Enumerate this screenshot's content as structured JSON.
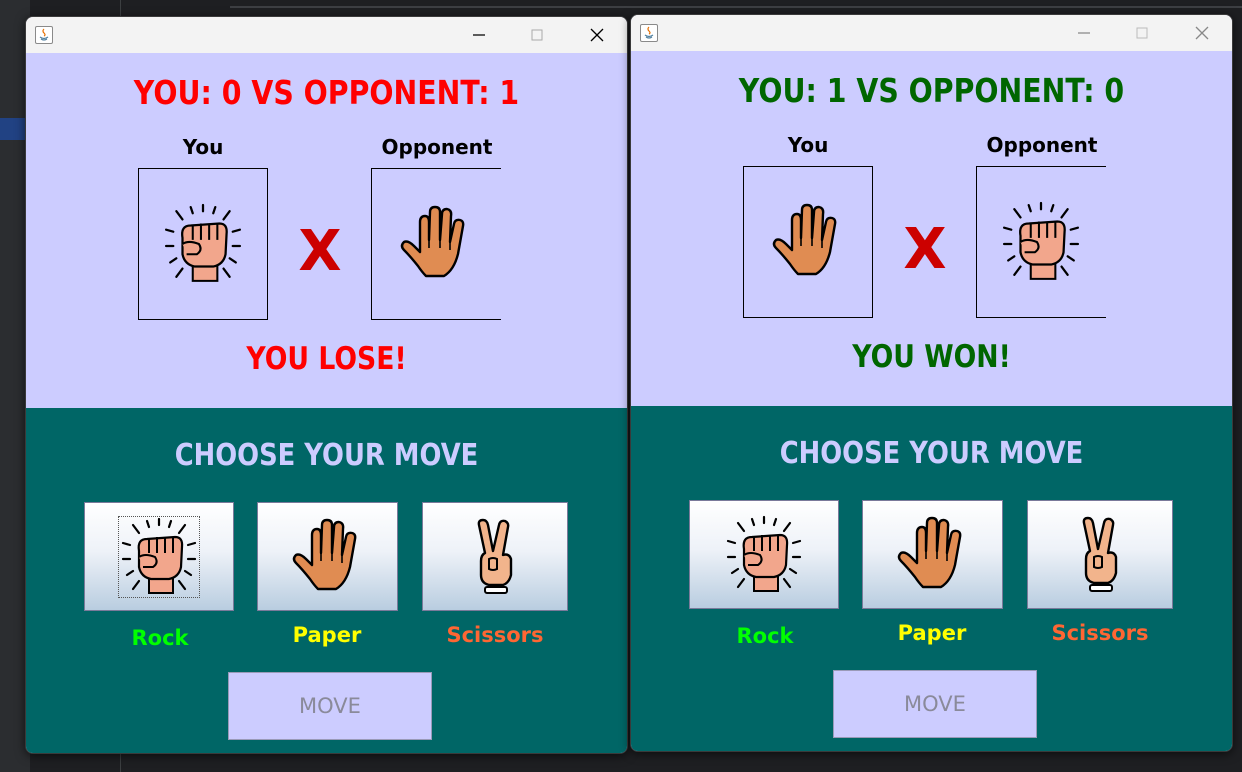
{
  "colors": {
    "lose": "#ff0000",
    "win": "#006600",
    "vs_x": "#cc0000",
    "panel_top": "#ccccff",
    "panel_bottom": "#006666",
    "rock_label": "#00ff00",
    "paper_label": "#ffff00",
    "scissors_label": "#ff6633"
  },
  "windows": [
    {
      "controls": [
        "minimize-icon",
        "maximize-icon",
        "close-icon"
      ],
      "score_text": "YOU: 0 VS OPPONENT: 1",
      "you_label": "You",
      "opponent_label": "Opponent",
      "you_hand": "rock-hand-icon",
      "opponent_hand": "paper-hand-icon",
      "vs_symbol": "X",
      "result_text": "YOU LOSE!",
      "choose_text": "CHOOSE YOUR MOVE",
      "moves": [
        {
          "label": "Rock",
          "icon": "rock-hand-icon"
        },
        {
          "label": "Paper",
          "icon": "paper-hand-icon"
        },
        {
          "label": "Scissors",
          "icon": "scissors-hand-icon"
        }
      ],
      "submit_label": "MOVE"
    },
    {
      "controls": [
        "minimize-icon",
        "maximize-icon",
        "close-icon"
      ],
      "score_text": "YOU: 1 VS OPPONENT: 0",
      "you_label": "You",
      "opponent_label": "Opponent",
      "you_hand": "paper-hand-icon",
      "opponent_hand": "rock-hand-icon",
      "vs_symbol": "X",
      "result_text": "YOU WON!",
      "choose_text": "CHOOSE YOUR MOVE",
      "moves": [
        {
          "label": "Rock",
          "icon": "rock-hand-icon"
        },
        {
          "label": "Paper",
          "icon": "paper-hand-icon"
        },
        {
          "label": "Scissors",
          "icon": "scissors-hand-icon"
        }
      ],
      "submit_label": "MOVE"
    }
  ]
}
